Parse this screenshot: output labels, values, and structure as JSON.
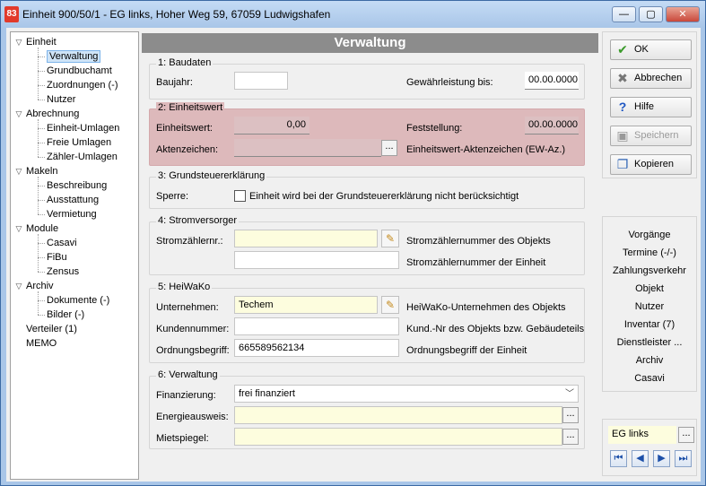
{
  "window": {
    "title": "Einheit 900/50/1 - EG links, Hoher Weg 59, 67059 Ludwigshafen",
    "app_icon_text": "83",
    "controls": {
      "minimize": "—",
      "maximize": "▢",
      "close": "✕"
    }
  },
  "tree": {
    "items": [
      {
        "label": "Einheit",
        "level": 0,
        "expander": "▽"
      },
      {
        "label": "Verwaltung",
        "level": 1,
        "selected": true
      },
      {
        "label": "Grundbuchamt",
        "level": 1
      },
      {
        "label": "Zuordnungen (-)",
        "level": 1
      },
      {
        "label": "Nutzer",
        "level": 1
      },
      {
        "label": "Abrechnung",
        "level": 0,
        "expander": "▽"
      },
      {
        "label": "Einheit-Umlagen",
        "level": 1
      },
      {
        "label": "Freie Umlagen",
        "level": 1
      },
      {
        "label": "Zähler-Umlagen",
        "level": 1
      },
      {
        "label": "Makeln",
        "level": 0,
        "expander": "▽"
      },
      {
        "label": "Beschreibung",
        "level": 1
      },
      {
        "label": "Ausstattung",
        "level": 1
      },
      {
        "label": "Vermietung",
        "level": 1
      },
      {
        "label": "Module",
        "level": 0,
        "expander": "▽"
      },
      {
        "label": "Casavi",
        "level": 1
      },
      {
        "label": "FiBu",
        "level": 1
      },
      {
        "label": "Zensus",
        "level": 1
      },
      {
        "label": "Archiv",
        "level": 0,
        "expander": "▽"
      },
      {
        "label": "Dokumente (-)",
        "level": 1
      },
      {
        "label": "Bilder (-)",
        "level": 1
      },
      {
        "label": "Verteiler (1)",
        "level": 0
      },
      {
        "label": "MEMO",
        "level": 0
      }
    ]
  },
  "main": {
    "header": "Verwaltung",
    "baudaten": {
      "title": "1: Baudaten",
      "baujahr_label": "Baujahr:",
      "baujahr_value": "",
      "gewaehr_label": "Gewährleistung bis:",
      "gewaehr_value": "00.00.0000"
    },
    "einheitswert": {
      "title": "2: Einheitswert",
      "wert_label": "Einheitswert:",
      "wert_value": "0,00",
      "feststellung_label": "Feststellung:",
      "feststellung_value": "00.00.0000",
      "aktenzeichen_label": "Aktenzeichen:",
      "aktenzeichen_value": "",
      "aktenzeichen_desc": "Einheitswert-Aktenzeichen (EW-Az.)"
    },
    "grundsteuer": {
      "title": "3: Grundsteuererklärung",
      "sperre_label": "Sperre:",
      "checkbox_label": "Einheit wird bei der Grundsteuererklärung nicht berücksichtigt",
      "checked": false
    },
    "strom": {
      "title": "4: Stromversorger",
      "nr_label": "Stromzählernr.:",
      "objekt_value": "",
      "objekt_desc": "Stromzählernummer des Objekts",
      "einheit_value": "",
      "einheit_desc": "Stromzählernummer der Einheit"
    },
    "heiwako": {
      "title": "5: HeiWaKo",
      "unternehmen_label": "Unternehmen:",
      "unternehmen_value": "Techem",
      "unternehmen_desc": "HeiWaKo-Unternehmen des Objekts",
      "kunden_label": "Kundennummer:",
      "kunden_value": "",
      "kunden_desc": "Kund.-Nr des Objekts bzw. Gebäudeteils",
      "ordnung_label": "Ordnungsbegriff:",
      "ordnung_value": "665589562134",
      "ordnung_desc": "Ordnungsbegriff der Einheit"
    },
    "verwaltung": {
      "title": "6: Verwaltung",
      "finanz_label": "Finanzierung:",
      "finanz_value": "frei finanziert",
      "energie_label": "Energieausweis:",
      "energie_value": "",
      "miet_label": "Mietspiegel:",
      "miet_value": ""
    }
  },
  "actions": {
    "ok": "OK",
    "abbrechen": "Abbrechen",
    "hilfe": "Hilfe",
    "speichern": "Speichern",
    "kopieren": "Kopieren"
  },
  "links": [
    "Vorgänge",
    "Termine (-/-)",
    "Zahlungsverkehr",
    "Objekt",
    "Nutzer",
    "Inventar (7)",
    "Dienstleister ...",
    "Archiv",
    "Casavi"
  ],
  "navigator": {
    "value": "EG links",
    "browse": "...",
    "first": "⏮",
    "prev": "◀",
    "next": "▶",
    "last": "⏭"
  },
  "colors": {
    "header_bg": "#8c8c8c",
    "highlight_group": "#ddb9bb",
    "yellow_field": "#fdfdde",
    "title_bar": "#a9c6e8"
  }
}
